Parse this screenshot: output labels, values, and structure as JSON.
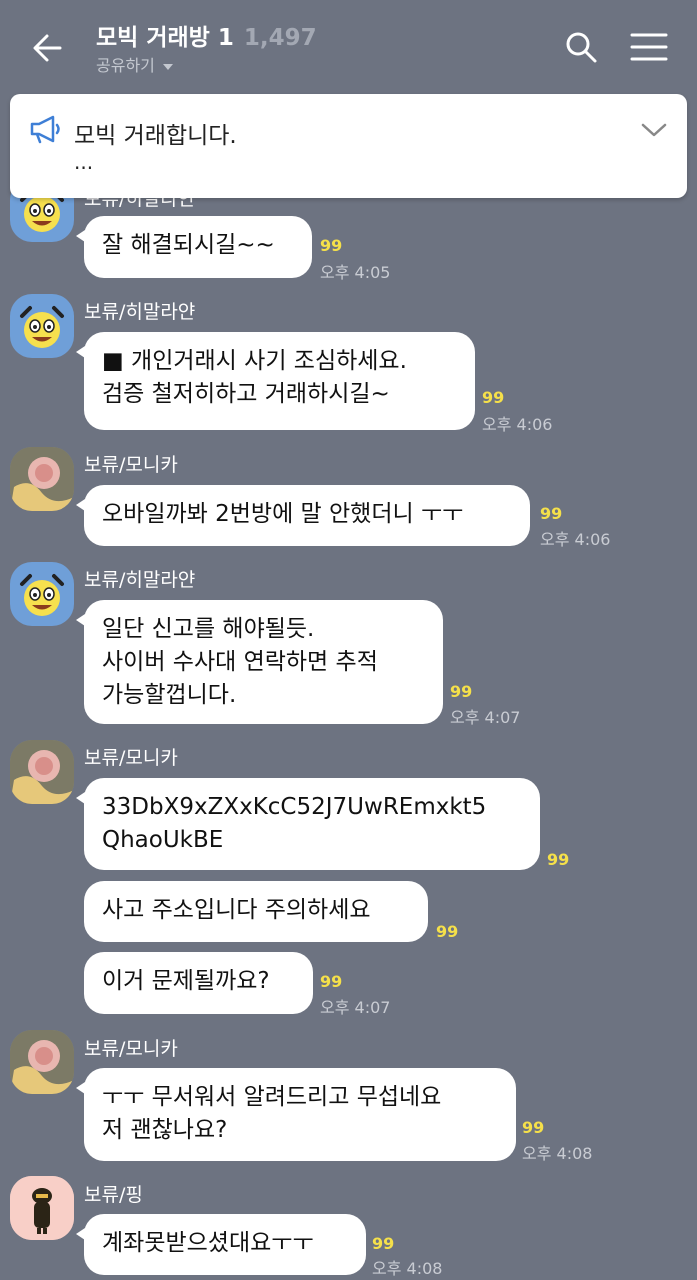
{
  "header": {
    "title": "모빅 거래방 1",
    "member_count": "1,497",
    "share_label": "공유하기"
  },
  "notice": {
    "title": "모빅 거래합니다.",
    "more": "..."
  },
  "messages": [
    {
      "sender": "보류/히말라얀",
      "text": "잘 해결되시길~~",
      "unread": "99",
      "time": "오후 4:05"
    },
    {
      "sender": "보류/히말라얀",
      "text": "■ 개인거래시 사기 조심하세요.\n검증 철저히하고 거래하시길~",
      "unread": "99",
      "time": "오후 4:06"
    },
    {
      "sender": "보류/모니카",
      "text": "오바일까봐 2번방에 말 안했더니 ㅜㅜ",
      "unread": "99",
      "time": "오후 4:06"
    },
    {
      "sender": "보류/히말라얀",
      "text": "일단 신고를 해야될듯.\n사이버 수사대 연락하면 추적\n가능할껍니다.",
      "unread": "99",
      "time": "오후 4:07"
    },
    {
      "sender": "보류/모니카",
      "text": "33DbX9xZXxKcC52J7UwREmxkt5\nQhaoUkBE",
      "unread": "99",
      "time": ""
    },
    {
      "sender": "",
      "text": "사고 주소입니다 주의하세요",
      "unread": "99",
      "time": ""
    },
    {
      "sender": "",
      "text": "이거 문제될까요?",
      "unread": "99",
      "time": "오후 4:07"
    },
    {
      "sender": "보류/모니카",
      "text": "ㅜㅜ 무서워서 알려드리고 무섭네요\n저 괜찮나요?",
      "unread": "99",
      "time": "오후 4:08"
    },
    {
      "sender": "보류/핑",
      "text": "계좌못받으셨대요ㅜㅜ",
      "unread": "99",
      "time": "오후 4:08"
    }
  ]
}
